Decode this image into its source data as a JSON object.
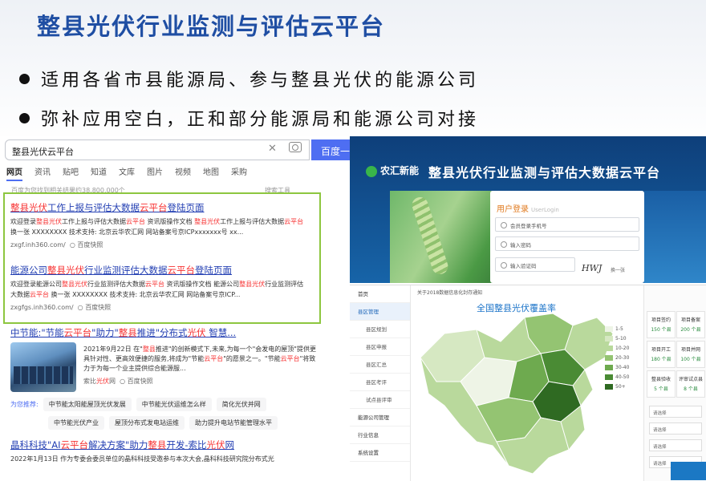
{
  "slide": {
    "title": "整县光伏行业监测与评估云平台",
    "bullets": [
      "适用各省市县能源局、参与整县光伏的能源公司",
      "弥补应用空白，正和部分能源局和能源公司对接"
    ]
  },
  "baidu": {
    "query": "整县光伏云平台",
    "search_button": "百度一",
    "tabs": [
      "网页",
      "资讯",
      "贴吧",
      "知道",
      "文库",
      "图片",
      "视频",
      "地图",
      "采购"
    ],
    "result_count": "百度为您找到相关结果约38,800,000个",
    "tools": "搜索工具",
    "results": [
      {
        "title": "整县光伏工作上报与评估大数据云平台登陆页面",
        "desc": "欢迎登录整县光伏工作上报与评估大数据云平台 资讯版操作文档 整县光伏工作上报与评估大数据云平台 换一张 XXXXXXXX 技术支持: 北京云华农汇网 网站备案号京ICPxxxxxxx号 xx...",
        "url": "zxgf.inh360.com/",
        "snap": "百度快照"
      },
      {
        "title": "能源公司整县光伏行业监测评估大数据云平台登陆页面",
        "desc": "欢迎登录能源公司整县光伏行业监测评估大数据云平台 资讯版操作文档 能源公司整县光伏行业监测评估大数据云平台 换一张 XXXXXXXX 技术支持: 北京云华农汇网 网站备案号京ICP...",
        "url": "zxgfgs.inh360.com/",
        "snap": "百度快照"
      },
      {
        "title": "中节能:\"节能云平台\"助力\"整县推进\"分布式光伏 智慧...",
        "desc": "2021年9月22日 在\"整县推进\"的创新模式下,未来,为每一个\"会发电的屋顶\"提供更具针对性、更高效便捷的服务,将成为\"节能云平台\"的愿景之一。\"节能云平台\"将致力于为每一个业主提供综合能源服...",
        "source": "索比光伏网",
        "snap": "百度快照"
      },
      {
        "title": "晶科科技\"AI云平台解决方案\"助力整县开发-索比光伏网",
        "desc": "2022年1月13日 作为专委会委员单位的晶科科技受邀参与本次大会,晶科科技研究院分布式光"
      }
    ],
    "recommend_label": "为您推荐:",
    "recommend": [
      "中节能太阳能屋顶光伏发展",
      "中节能光伏运维怎么样",
      "简化光伏并网",
      "中节能光伏产业",
      "屋顶分布式发电站运维",
      "助力提升电站节能管理水平"
    ]
  },
  "platform": {
    "brand": "农汇新能",
    "title": "整县光伏行业监测与评估大数据云平台",
    "login_title": "用户登录",
    "login_sub": "UserLogin",
    "fields": [
      "会员登录手机号",
      "输入密码",
      "输入验证码"
    ],
    "captcha": "HWJ",
    "captcha_refresh": "换一张"
  },
  "map_panel": {
    "sidebar": [
      {
        "label": "首页",
        "sub": false
      },
      {
        "label": "县区管理",
        "sub": false,
        "active": true
      },
      {
        "label": "县区规划",
        "sub": true
      },
      {
        "label": "县区申报",
        "sub": true
      },
      {
        "label": "县区汇总",
        "sub": true
      },
      {
        "label": "县区考评",
        "sub": true
      },
      {
        "label": "试点县评审",
        "sub": true
      },
      {
        "label": "能源公司管理",
        "sub": false
      },
      {
        "label": "行业信息",
        "sub": false
      },
      {
        "label": "系统设置",
        "sub": false
      }
    ],
    "header_note": "关于2018数据信息化封存通知",
    "map_title": "全国整县光伏覆盖率",
    "legend": [
      "1-5",
      "5-10",
      "10-20",
      "20-30",
      "30-40",
      "40-50",
      "50+"
    ],
    "legend_colors": [
      "#eef4e6",
      "#d6e8c2",
      "#b9d99c",
      "#94c472",
      "#6eaa4f",
      "#4a8b34",
      "#2f6a22"
    ],
    "stats": [
      {
        "label": "项目签约",
        "value": "150 个县"
      },
      {
        "label": "项目备案",
        "value": "200 个县"
      },
      {
        "label": "项目开工",
        "value": "180 个县"
      },
      {
        "label": "项目并网",
        "value": "100 个县"
      },
      {
        "label": "整县验收",
        "value": "5 个县"
      },
      {
        "label": "评审试点县",
        "value": "8 个县"
      }
    ],
    "selects": [
      "请选择",
      "请选择",
      "请选择",
      "请选择"
    ]
  }
}
